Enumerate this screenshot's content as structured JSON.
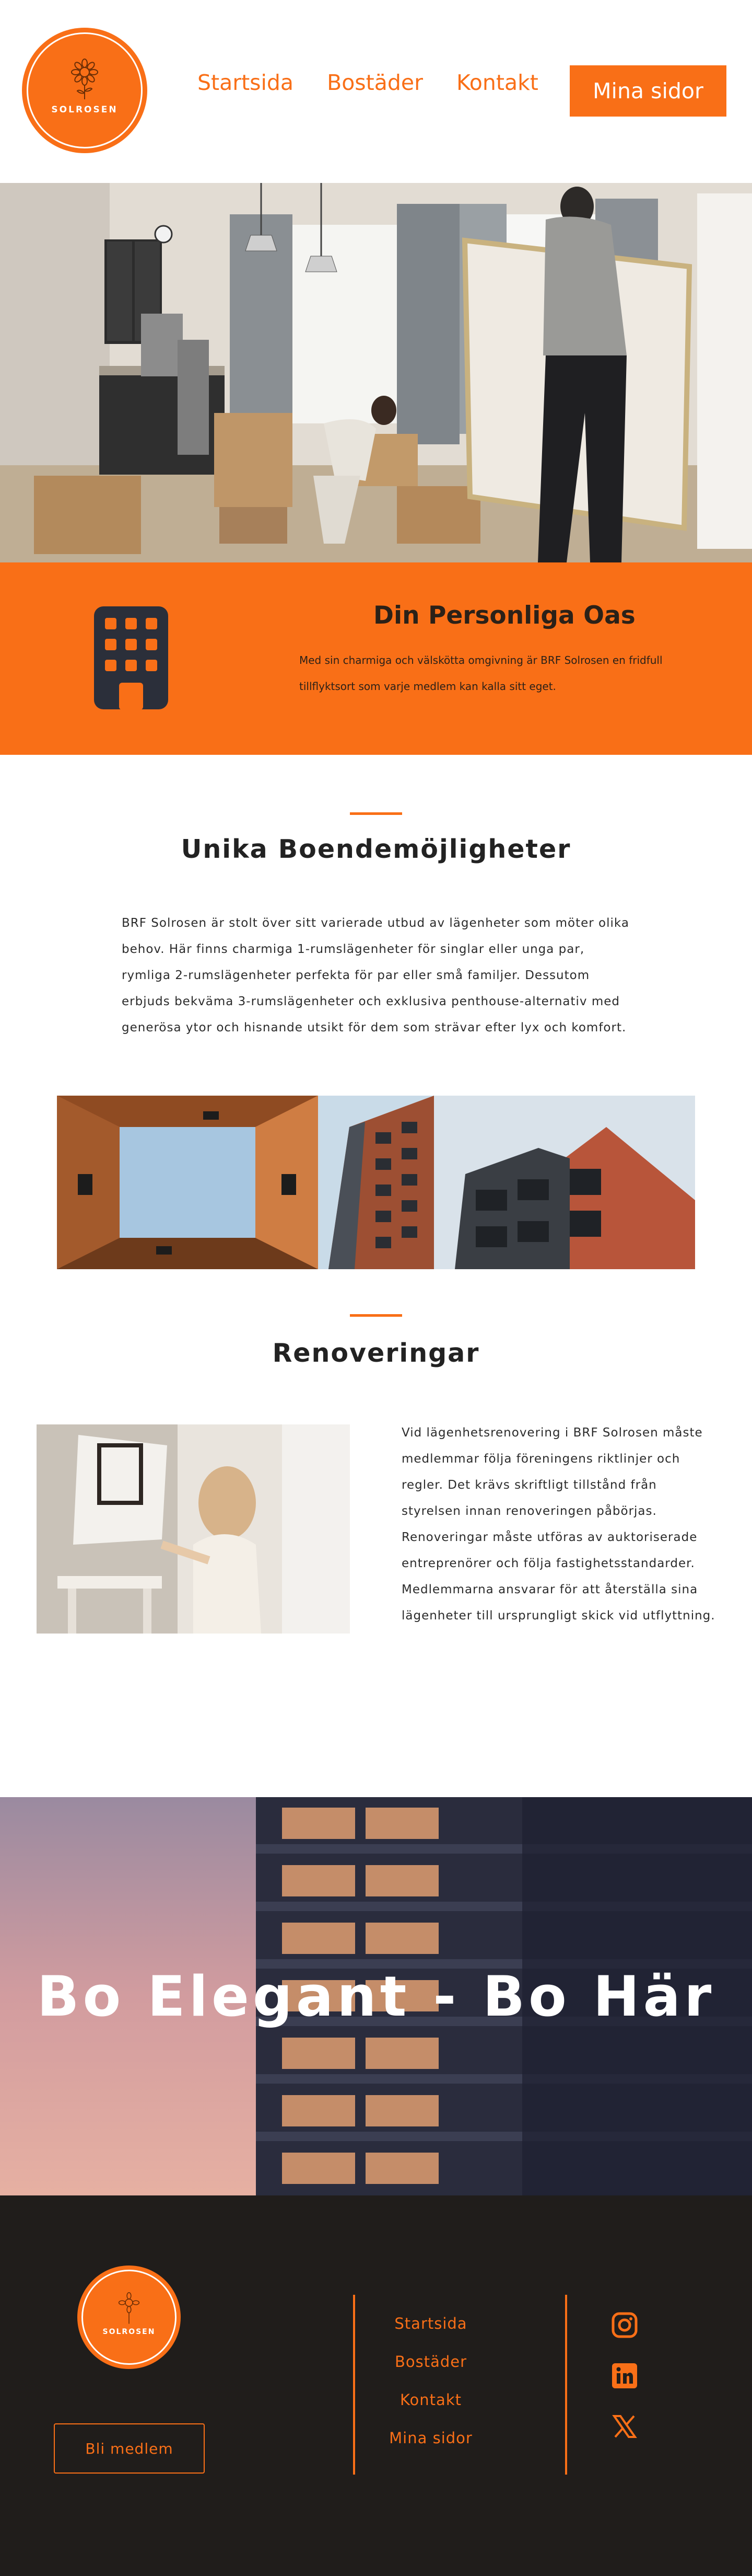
{
  "header": {
    "logo_text": "SOLROSEN",
    "nav": [
      "Startsida",
      "Bostäder",
      "Kontakt"
    ],
    "cta_label": "Mina sidor"
  },
  "banner": {
    "icon": "building-icon",
    "title": "Din Personliga Oas",
    "text": "Med sin charmiga och välskötta omgivning är BRF Solrosen en fridfull tillflyktsort som varje medlem kan kalla sitt eget."
  },
  "unika": {
    "title": "Unika Boendemöjligheter",
    "text": "BRF Solrosen är stolt över sitt varierade utbud av lägenheter som möter olika behov. Här finns charmiga 1-rumslägenheter för singlar eller unga par, rymliga 2-rumslägenheter perfekta för par eller små familjer. Dessutom erbjuds bekväma 3-rumslägenheter och exklusiva penthouse-alternativ med generösa ytor och hisnande utsikt för dem som strävar efter lyx och komfort."
  },
  "reno": {
    "title": "Renoveringar",
    "text": "Vid lägenhetsrenovering i BRF Solrosen måste medlemmar följa föreningens riktlinjer och regler. Det krävs skriftligt tillstånd från styrelsen innan renoveringen påbörjas. Renoveringar måste utföras av auktoriserade entreprenörer och följa fastighetsstandarder. Medlemmarna ansvarar för att återställa sina lägenheter till ursprungligt skick vid utflyttning."
  },
  "elegant": {
    "title": "Bo Elegant - Bo Här"
  },
  "footer": {
    "logo_text": "SOLROSEN",
    "join_label": "Bli medlem",
    "links": [
      "Startsida",
      "Bostäder",
      "Kontakt",
      "Mina sidor"
    ],
    "social": [
      "instagram-icon",
      "linkedin-icon",
      "x-icon"
    ]
  },
  "colors": {
    "accent": "#f96f17",
    "footer_bg": "#201d1b",
    "text": "#2b2b2b"
  }
}
